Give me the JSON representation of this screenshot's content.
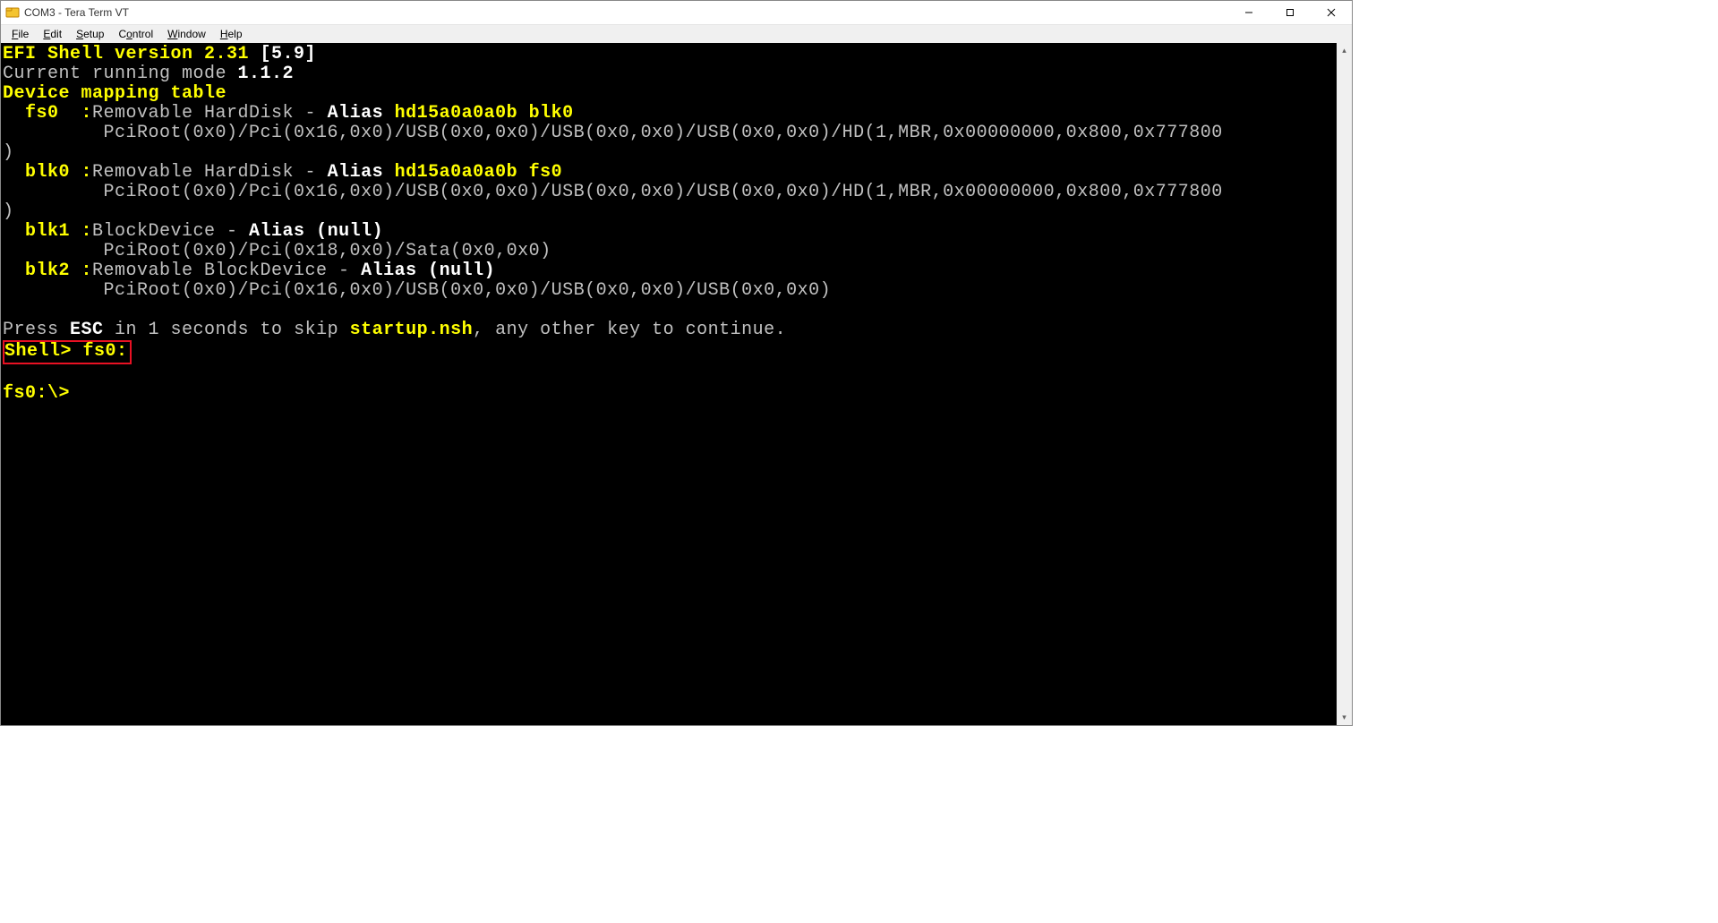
{
  "window": {
    "title": "COM3 - Tera Term VT"
  },
  "menus": {
    "file": "File",
    "edit": "Edit",
    "setup": "Setup",
    "control": "Control",
    "window": "Window",
    "help": "Help"
  },
  "term": {
    "l1a": "EFI Shell version 2.31 ",
    "l1b": "[5.9]",
    "l2a": "Current running mode ",
    "l2b": "1.1.2",
    "l3": "Device mapping table",
    "l4a": "  fs0  :",
    "l4b": "Removable HardDisk - ",
    "l4c": "Alias ",
    "l4d": "hd15a0a0a0b blk0",
    "l5": "         PciRoot(0x0)/Pci(0x16,0x0)/USB(0x0,0x0)/USB(0x0,0x0)/USB(0x0,0x0)/HD(1,MBR,0x00000000,0x800,0x777800",
    "l6": ")",
    "l7a": "  blk0 :",
    "l7b": "Removable HardDisk - ",
    "l7c": "Alias ",
    "l7d": "hd15a0a0a0b fs0",
    "l8": "         PciRoot(0x0)/Pci(0x16,0x0)/USB(0x0,0x0)/USB(0x0,0x0)/USB(0x0,0x0)/HD(1,MBR,0x00000000,0x800,0x777800",
    "l9": ")",
    "l10a": "  blk1 :",
    "l10b": "BlockDevice - ",
    "l10c": "Alias ",
    "l10d": "(null)",
    "l11": "         PciRoot(0x0)/Pci(0x18,0x0)/Sata(0x0,0x0)",
    "l12a": "  blk2 :",
    "l12b": "Removable BlockDevice - ",
    "l12c": "Alias ",
    "l12d": "(null)",
    "l13": "         PciRoot(0x0)/Pci(0x16,0x0)/USB(0x0,0x0)/USB(0x0,0x0)/USB(0x0,0x0)",
    "l14a": "Press ",
    "l14b": "ESC",
    "l14c": " in 1 seconds to skip ",
    "l14d": "startup.nsh",
    "l14e": ", any other key to continue.",
    "l15a": "Shell> ",
    "l15b": "fs0:",
    "l16": "fs0:\\>"
  }
}
